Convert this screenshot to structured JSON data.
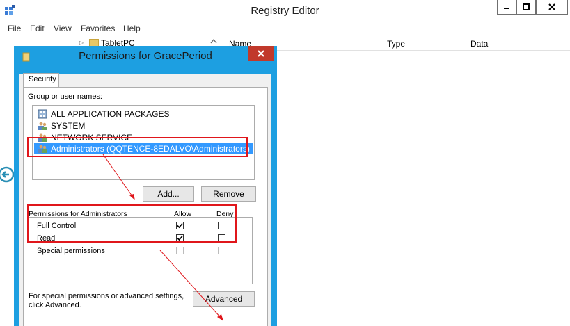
{
  "window": {
    "title": "Registry Editor"
  },
  "menu": [
    "File",
    "Edit",
    "View",
    "Favorites",
    "Help"
  ],
  "tree": {
    "visible_item": "TabletPC"
  },
  "list": {
    "columns": [
      "Name",
      "Type",
      "Data"
    ]
  },
  "dialog": {
    "title": "Permissions for GracePeriod",
    "tab": "Security",
    "group_label": "Group or user names:",
    "users": [
      {
        "name": "ALL APPLICATION PACKAGES",
        "icon": "package-group-icon",
        "selected": false
      },
      {
        "name": "SYSTEM",
        "icon": "users-icon",
        "selected": false
      },
      {
        "name": "NETWORK SERVICE",
        "icon": "users-icon",
        "selected": false
      },
      {
        "name": "Administrators (QQTENCE-8EDALVO\\Administrators)",
        "icon": "users-icon",
        "selected": true
      }
    ],
    "add_button": "Add...",
    "remove_button": "Remove",
    "perm_label": "Permissions for Administrators",
    "allow_label": "Allow",
    "deny_label": "Deny",
    "permissions": [
      {
        "name": "Full Control",
        "allow": true,
        "deny": false,
        "enabled": true
      },
      {
        "name": "Read",
        "allow": true,
        "deny": false,
        "enabled": true
      },
      {
        "name": "Special permissions",
        "allow": false,
        "deny": false,
        "enabled": false
      }
    ],
    "advanced_text_1": "For special permissions or advanced settings,",
    "advanced_text_2": "click Advanced.",
    "advanced_button": "Advanced"
  },
  "colors": {
    "dialog_frame": "#1d9fe1",
    "selection": "#3399ff",
    "annotation": "#e0161b",
    "close_button": "#c1392b"
  }
}
